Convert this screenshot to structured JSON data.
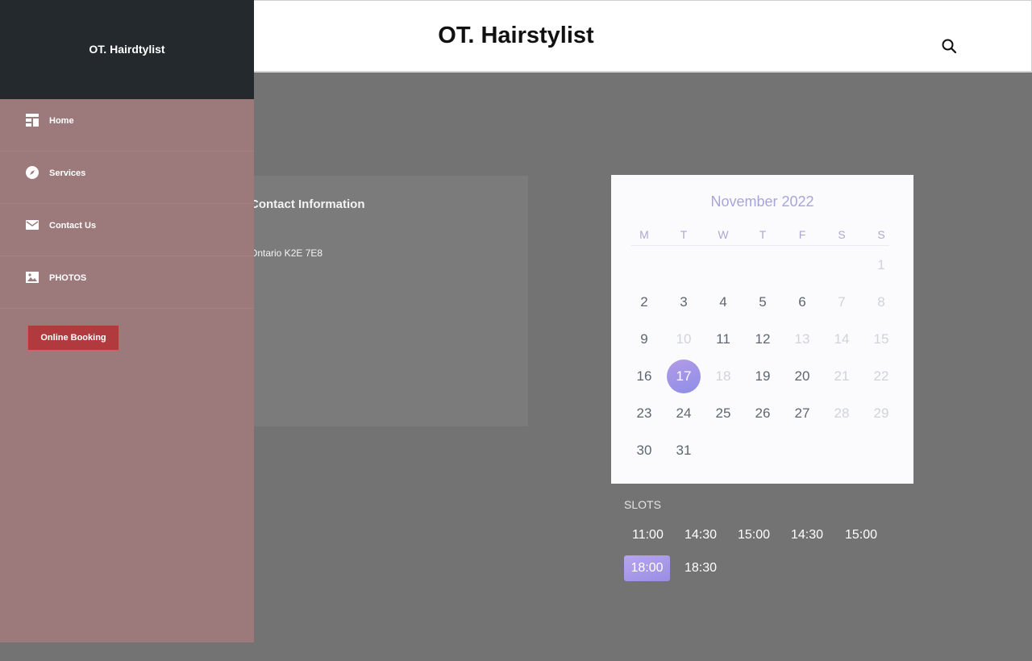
{
  "header": {
    "title": "OT. Hairstylist",
    "search_icon": "search-icon"
  },
  "sidebar": {
    "brand": "OT. Hairdtylist",
    "items": [
      {
        "label": "Home",
        "icon": "dashboard-icon"
      },
      {
        "label": "Services",
        "icon": "compass-icon"
      },
      {
        "label": "Contact Us",
        "icon": "envelope-icon"
      },
      {
        "label": "PHOTOS",
        "icon": "image-icon"
      }
    ],
    "booking_button": "Online Booking"
  },
  "contact": {
    "title": "Contact Information",
    "address": "Ontario K2E 7E8"
  },
  "calendar": {
    "month": "November 2022",
    "weekdays": [
      "M",
      "T",
      "W",
      "T",
      "F",
      "S",
      "S"
    ],
    "weeks": [
      [
        "",
        "",
        "",
        "",
        "",
        "",
        "1"
      ],
      [
        "2",
        "3",
        "4",
        "5",
        "6",
        "7",
        "8"
      ],
      [
        "9",
        "10",
        "11",
        "12",
        "13",
        "14",
        "15"
      ],
      [
        "16",
        "17",
        "18",
        "19",
        "20",
        "21",
        "22"
      ],
      [
        "23",
        "24",
        "25",
        "26",
        "27",
        "28",
        "29"
      ],
      [
        "30",
        "31",
        "",
        "",
        "",
        "",
        ""
      ]
    ],
    "unavailable_days": [
      "1",
      "7",
      "8",
      "10",
      "13",
      "14",
      "15",
      "18",
      "21",
      "22",
      "28",
      "29"
    ],
    "selected_day": "17"
  },
  "slots": {
    "label": "SLOTS",
    "times": [
      "11:00",
      "14:30",
      "15:00",
      "14:30",
      "15:00",
      "18:00",
      "18:30"
    ],
    "selected_index": 5
  },
  "colors": {
    "accent": "#9a8ee3",
    "sidebar_bg": "#9c7a7c",
    "sidebar_header_bg": "#24292e",
    "booking_button": "#b03a3e"
  }
}
